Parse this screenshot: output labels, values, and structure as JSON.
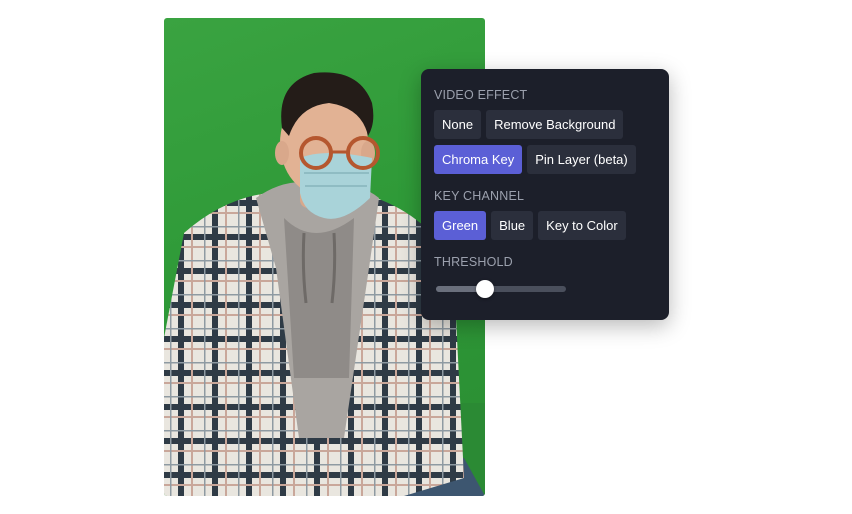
{
  "panel": {
    "video_effect": {
      "label": "VIDEO EFFECT",
      "options": [
        {
          "label": "None",
          "active": false
        },
        {
          "label": "Remove Background",
          "active": false
        },
        {
          "label": "Chroma Key",
          "active": true
        },
        {
          "label": "Pin Layer (beta)",
          "active": false
        }
      ]
    },
    "key_channel": {
      "label": "KEY CHANNEL",
      "options": [
        {
          "label": "Green",
          "active": true
        },
        {
          "label": "Blue",
          "active": false
        },
        {
          "label": "Key to Color",
          "active": false
        }
      ]
    },
    "threshold": {
      "label": "THRESHOLD",
      "value": 0.38
    }
  },
  "colors": {
    "panel_bg": "#1c1f2a",
    "button_bg": "#2b2f3c",
    "active_accent": "#5b5fd6",
    "green_screen": "#3aa341"
  }
}
